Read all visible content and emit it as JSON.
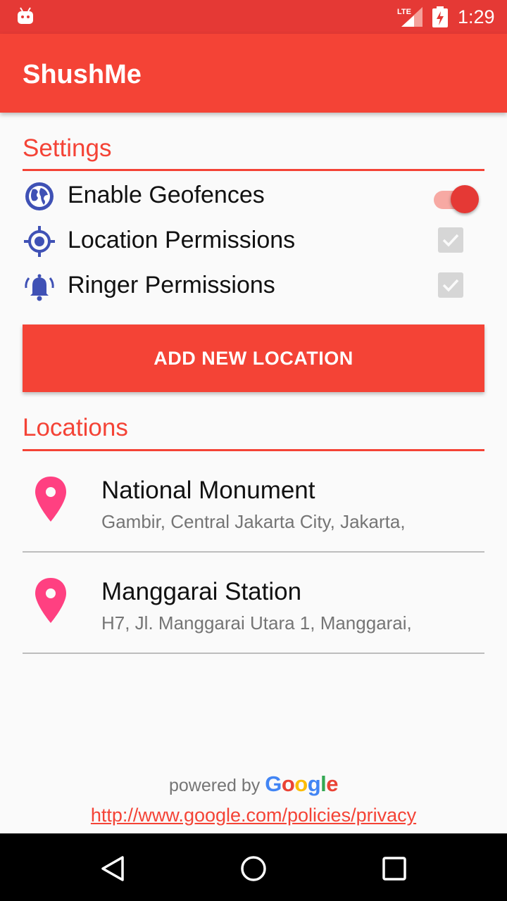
{
  "status_bar": {
    "network": "LTE",
    "time": "1:29"
  },
  "app_bar": {
    "title": "ShushMe"
  },
  "settings": {
    "title": "Settings",
    "items": [
      {
        "label": "Enable Geofences",
        "icon": "globe-icon",
        "control": "switch",
        "checked": true
      },
      {
        "label": "Location Permissions",
        "icon": "gps-target-icon",
        "control": "checkbox",
        "checked": true,
        "disabled": true
      },
      {
        "label": "Ringer Permissions",
        "icon": "bell-ringing-icon",
        "control": "checkbox",
        "checked": true,
        "disabled": true
      }
    ]
  },
  "add_button": {
    "label": "ADD NEW LOCATION"
  },
  "locations": {
    "title": "Locations",
    "items": [
      {
        "name": "National Monument",
        "address": "Gambir, Central Jakarta City, Jakarta,",
        "icon": "map-pin-icon"
      },
      {
        "name": "Manggarai Station",
        "address": "H7, Jl. Manggarai Utara 1, Manggarai,",
        "icon": "map-pin-icon"
      }
    ]
  },
  "footer": {
    "powered_by": "powered by",
    "google": "Google",
    "privacy_link": "http://www.google.com/policies/privacy"
  },
  "colors": {
    "primary": "#f44336",
    "primary_dark": "#e53935",
    "pin": "#ff4081",
    "icon_blue": "#3f51b5"
  }
}
